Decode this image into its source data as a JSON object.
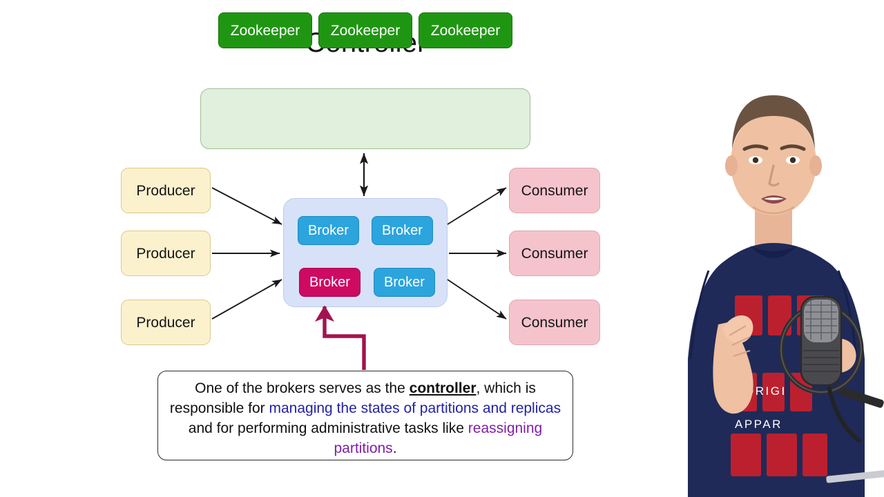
{
  "slide": {
    "title": "Controller",
    "background_color": "#ffffff"
  },
  "zookeeper_group": {
    "group_color": "#E1EFDD",
    "node_color": "#1F9612",
    "nodes": [
      {
        "label": "Zookeeper"
      },
      {
        "label": "Zookeeper"
      },
      {
        "label": "Zookeeper"
      }
    ]
  },
  "broker_group": {
    "group_color": "#D7E2F8",
    "node_color": "#2CA4DD",
    "controller_color": "#CE0A62",
    "nodes": [
      {
        "label": "Broker",
        "role": "broker"
      },
      {
        "label": "Broker",
        "role": "broker"
      },
      {
        "label": "Broker",
        "role": "controller"
      },
      {
        "label": "Broker",
        "role": "broker"
      }
    ]
  },
  "producers": {
    "color": "#FBF1CD",
    "nodes": [
      {
        "label": "Producer"
      },
      {
        "label": "Producer"
      },
      {
        "label": "Producer"
      }
    ]
  },
  "consumers": {
    "color": "#F5C3CC",
    "nodes": [
      {
        "label": "Consumer"
      },
      {
        "label": "Consumer"
      },
      {
        "label": "Consumer"
      }
    ]
  },
  "caption": {
    "border_color": "#2A2A2A",
    "segment_1": "One of the brokers serves as the ",
    "segment_2_bold": "controller",
    "segment_3": ", which is responsible for ",
    "segment_4_blue": "managing the states of partitions and replicas",
    "segment_5": " and for performing administrative tasks like ",
    "segment_6_purple": "reassigning partitions",
    "segment_7": ".",
    "blue_color": "#2222AA",
    "purple_color": "#7E1FA8"
  },
  "connectors": {
    "arrow_color": "#1A1A1A",
    "controller_pointer_color": "#A3134F"
  }
}
